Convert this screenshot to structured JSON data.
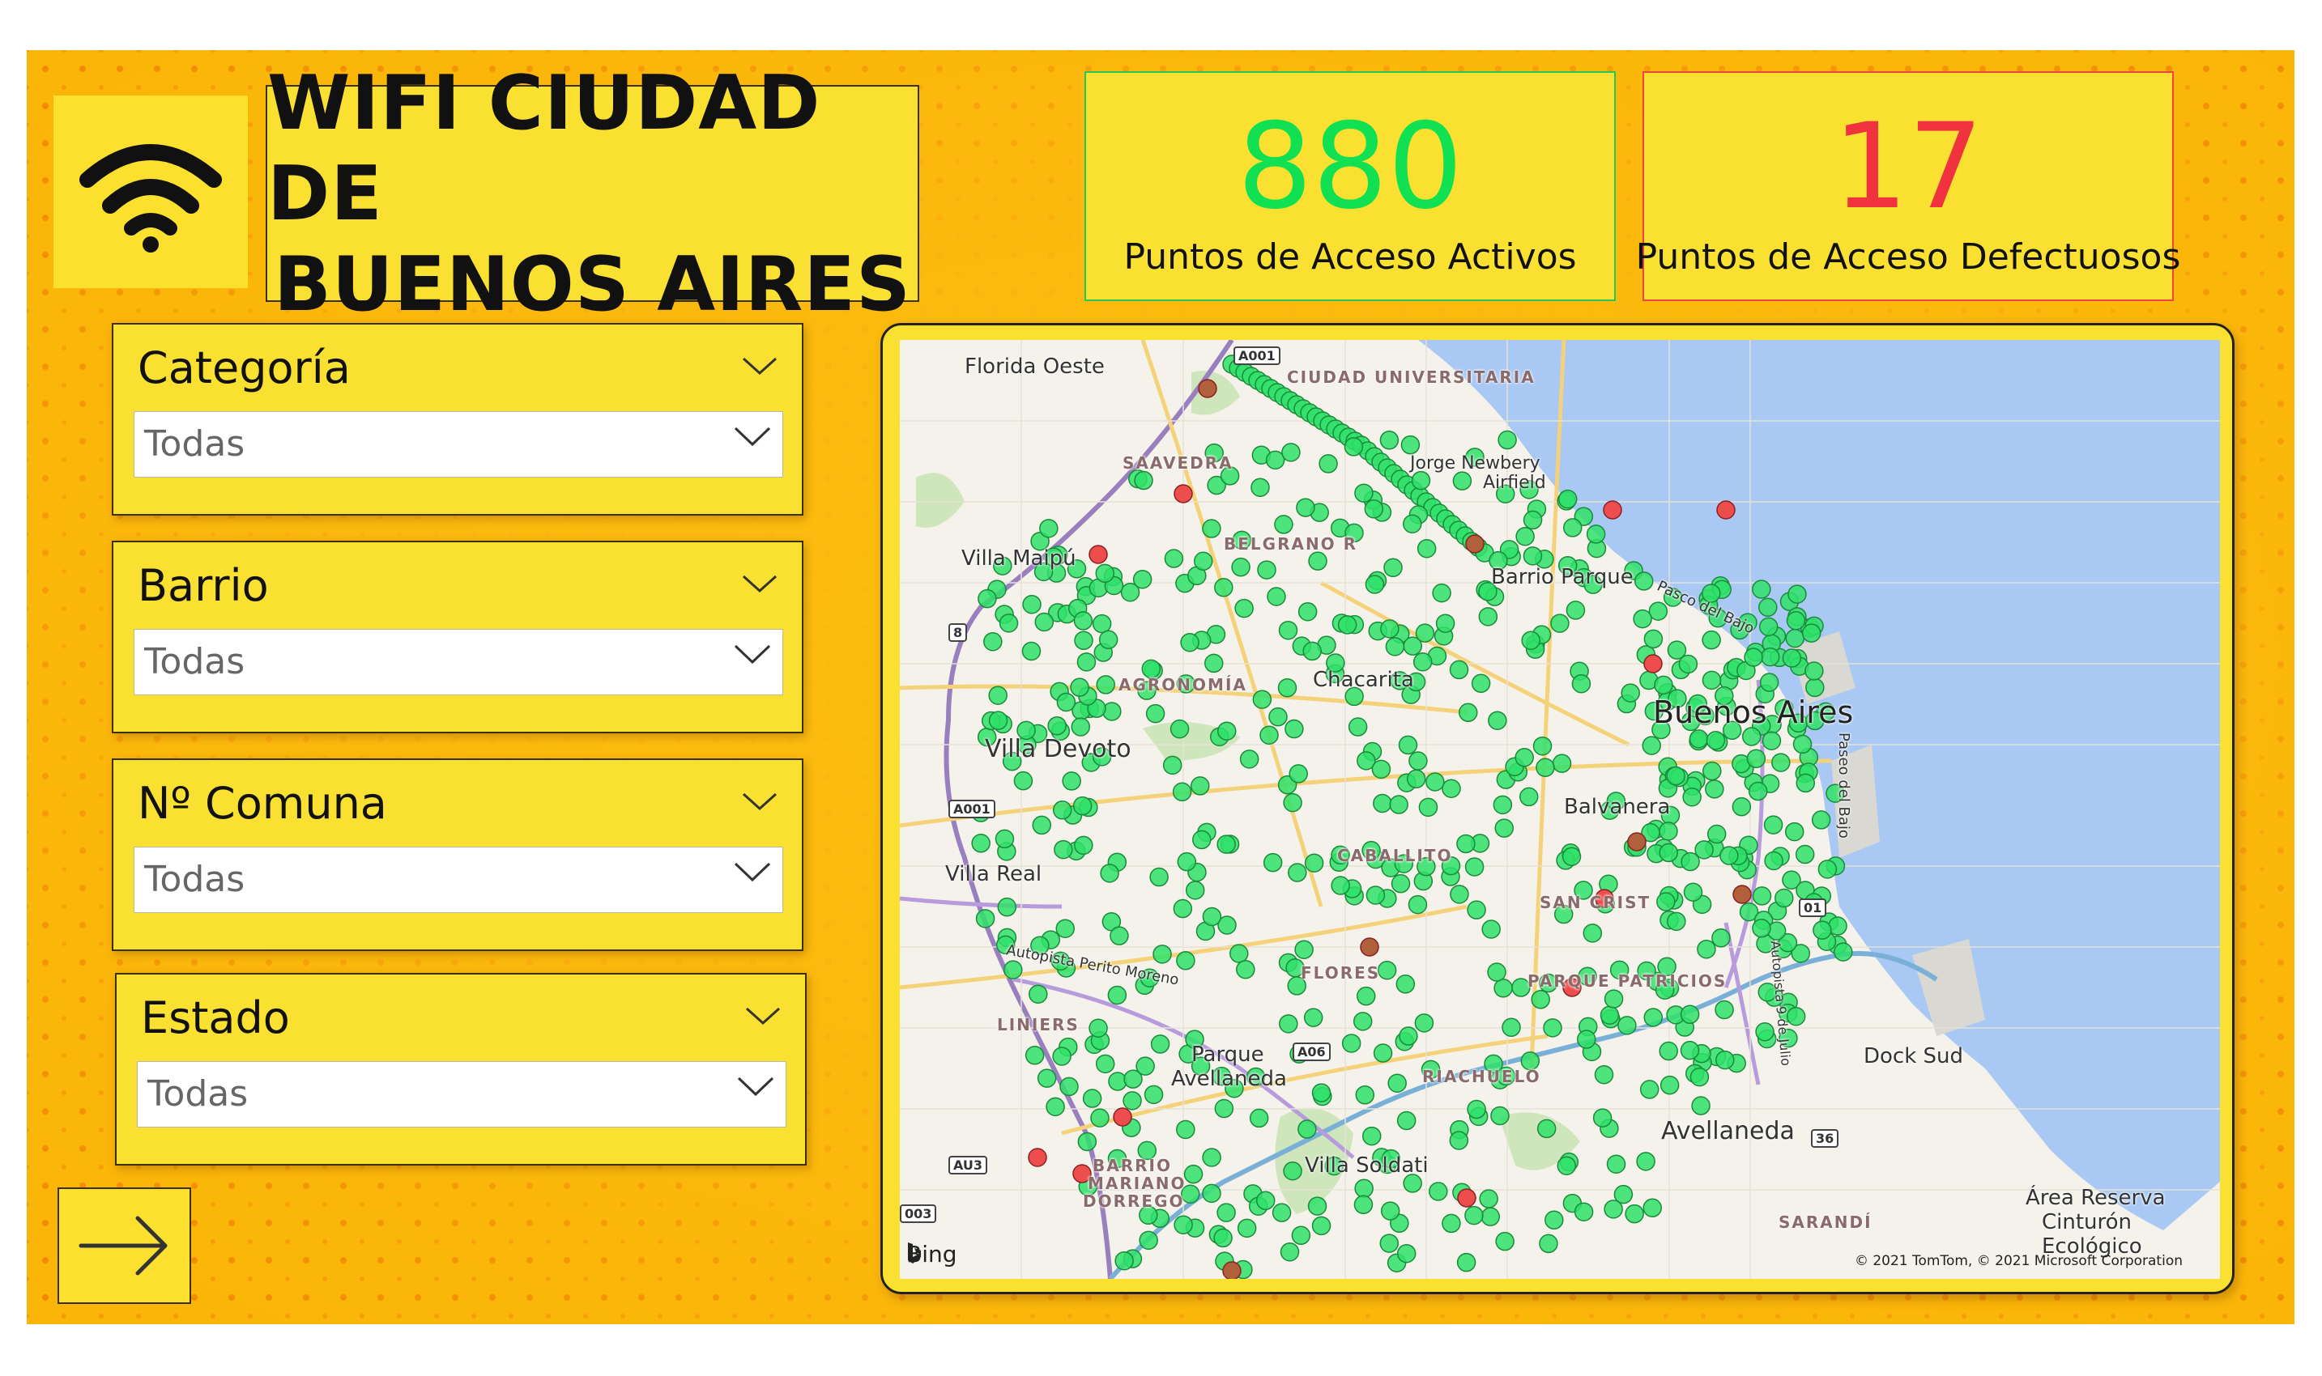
{
  "header": {
    "title_line1": "WIFI CIUDAD DE",
    "title_line2": "BUENOS AIRES",
    "logo_icon": "wifi-icon"
  },
  "kpis": {
    "active": {
      "value": "880",
      "label": "Puntos de Acceso Activos",
      "color": "#11e052"
    },
    "defective": {
      "value": "17",
      "label": "Puntos de Acceso Defectuosos",
      "color": "#f0313e"
    }
  },
  "filters": [
    {
      "label": "Categoría",
      "value": "Todas"
    },
    {
      "label": "Barrio",
      "value": "Todas"
    },
    {
      "label": "Nº Comuna",
      "value": "Todas"
    },
    {
      "label": "Estado",
      "value": "Todas"
    }
  ],
  "navigation": {
    "next_icon": "arrow-right-icon"
  },
  "map": {
    "labels": {
      "florida_oeste": "Florida Oeste",
      "ciudad_universitaria": "CIUDAD UNIVERSITARIA",
      "saavedra": "SAAVEDRA",
      "jorge_newbery": "Jorge Newbery",
      "airfield": "Airfield",
      "villa_maipu": "Villa Maipú",
      "belgrano": "BELGRANO R",
      "barrio_parque": "Barrio Parque",
      "puerto_madero": "Pasco del Bajo",
      "agronomia": "AGRONOMÍA",
      "chacarita": "Chacarita",
      "buenos_aires": "Buenos Aires",
      "villa_devoto": "Villa Devoto",
      "balvanera": "Balvanera",
      "caballito": "CABALLITO",
      "villa_real": "Villa Real",
      "san_cristobal": "SAN CRIST",
      "flores": "FLORES",
      "parque_patricios": "PARQUE PATRICIOS",
      "autopista_perito": "Autopista Perito Moreno",
      "liniers": "LINIERS",
      "parque_avellaneda_1": "Parque",
      "parque_avellaneda_2": "Avellaneda",
      "riachuelo": "RIACHUELO",
      "dock_sud": "Dock Sud",
      "avellaneda": "Avellaneda",
      "villa_soldati": "Villa Soldati",
      "barrio_mariano": "BARRIO",
      "barrio_mariano_2": "MARIANO",
      "barrio_mariano_3": "DORREGO",
      "sarandi": "SARANDÍ",
      "reserva_1": "Área Reserva",
      "reserva_2": "Cinturón",
      "reserva_3": "Ecológico",
      "costanera": "Paseo del Bajo",
      "autopista_sur": "Autopista 9 de Julio"
    },
    "shields": [
      "A001",
      "8",
      "A001",
      "AU3",
      "01",
      "36",
      "A06",
      "003"
    ],
    "attribution_logo": "Bing",
    "copyright": "© 2021 TomTom, © 2021 Microsoft Corporation",
    "legend_colors": {
      "active": "#2fe06a",
      "defective": "#ee4d4d",
      "defective_dark": "#b0603a",
      "water": "#a9c8f3"
    }
  }
}
